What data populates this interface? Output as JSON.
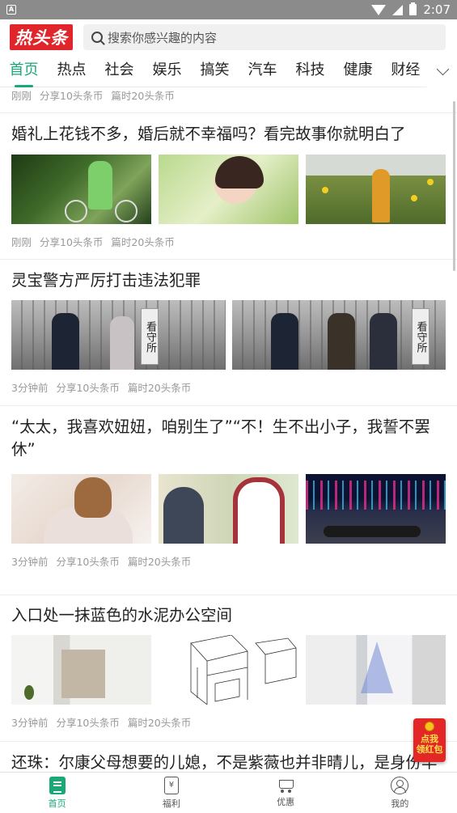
{
  "status_bar": {
    "time": "2:07",
    "notification_icon": "A"
  },
  "header": {
    "logo_text": "热头条",
    "search_placeholder": "搜索你感兴趣的内容"
  },
  "tabs": [
    {
      "label": "首页",
      "active": true
    },
    {
      "label": "热点"
    },
    {
      "label": "社会"
    },
    {
      "label": "娱乐"
    },
    {
      "label": "搞笑"
    },
    {
      "label": "汽车"
    },
    {
      "label": "科技"
    },
    {
      "label": "健康"
    },
    {
      "label": "财经"
    }
  ],
  "feed": {
    "top_meta": {
      "time": "刚刚",
      "share": "分享10头条币",
      "reward": "篇时20头条币"
    },
    "articles": [
      {
        "title": "婚礼上花钱不多，婚后就不幸福吗？看完故事你就明白了",
        "time": "刚刚",
        "share": "分享10头条币",
        "reward": "篇时20头条币",
        "images": [
          "woman-with-bicycle",
          "woman-portrait-green",
          "woman-in-sunflower-field"
        ]
      },
      {
        "title": "灵宝警方严厉打击违法犯罪",
        "time": "3分钟前",
        "share": "分享10头条币",
        "reward": "篇时20头条币",
        "images": [
          "police-escort-detention-center",
          "police-escort-suspects"
        ],
        "sign_text_1": "看守所",
        "sign_text_2": "看守所"
      },
      {
        "title": "“太太，我喜欢妞妞，咱别生了”“不！生不出小子，我誓不罢休”",
        "time": "3分钟前",
        "share": "分享10头条币",
        "reward": "篇时20头条币",
        "images": [
          "woman-in-white-sweater",
          "couple-arguing-tv-still",
          "person-lying-on-city-street"
        ]
      },
      {
        "title": "入口处一抹蓝色的水泥办公空间",
        "time": "3分钟前",
        "share": "分享10头条币",
        "reward": "篇时20头条币",
        "images": [
          "office-entrance-interior",
          "architectural-line-drawing",
          "blue-light-corridor"
        ]
      },
      {
        "title": "还珠：尔康父母想要的儿媳，不是紫薇也并非晴儿，是身份毕"
      }
    ]
  },
  "red_packet": {
    "line1": "点我",
    "line2": "领红包"
  },
  "bottom_nav": [
    {
      "label": "首页",
      "icon": "home-icon",
      "active": true
    },
    {
      "label": "福利",
      "icon": "gift-icon",
      "glyph": "¥"
    },
    {
      "label": "优惠",
      "icon": "cart-icon"
    },
    {
      "label": "我的",
      "icon": "user-icon"
    }
  ],
  "colors": {
    "accent": "#1aa877",
    "logo_red": "#e0262b",
    "status_bar": "#8b8b8b"
  }
}
